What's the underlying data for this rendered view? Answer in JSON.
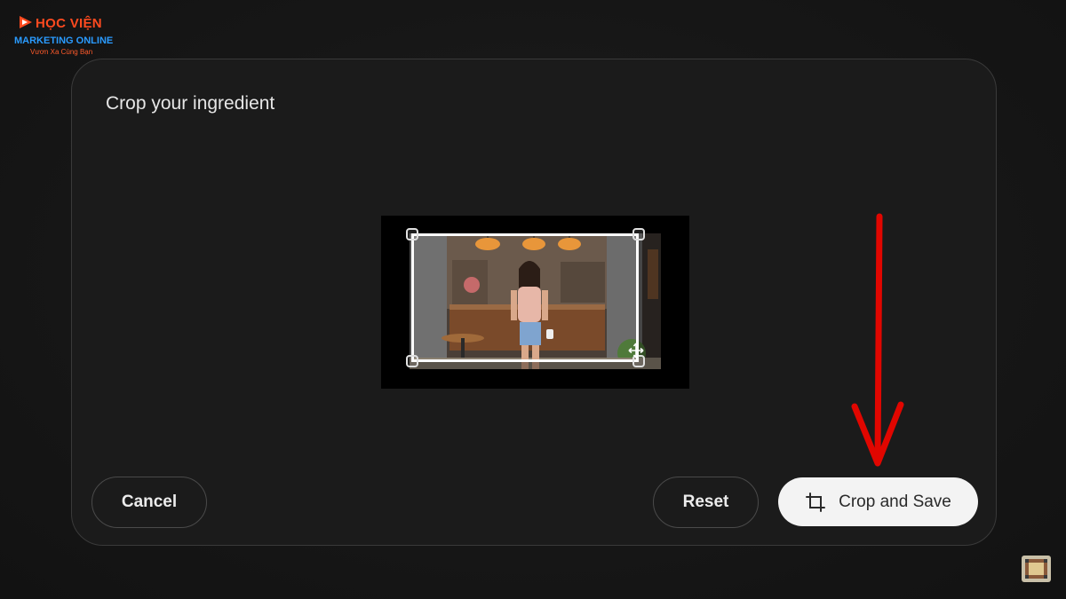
{
  "logo": {
    "top_text": "HỌC VIỆN",
    "mid_text": "MARKETING ONLINE",
    "slogan": "Vươn Xa Cùng Bạn",
    "icon": "play-logo-icon"
  },
  "dialog": {
    "title": "Crop your ingredient",
    "preview": {
      "icons": [
        "corner-handle-icon",
        "move-icon"
      ]
    },
    "actions": {
      "cancel_label": "Cancel",
      "reset_label": "Reset",
      "save_label": "Crop and Save",
      "save_icon": "crop-icon"
    }
  },
  "annotation": {
    "icon": "red-arrow-down-icon",
    "color": "#e10600"
  },
  "colors": {
    "background": "#161616",
    "dialog": "#1b1b1b",
    "primary_button": "#f3f3f3",
    "logo_red": "#ff4a1f",
    "logo_blue": "#2a9bff"
  }
}
